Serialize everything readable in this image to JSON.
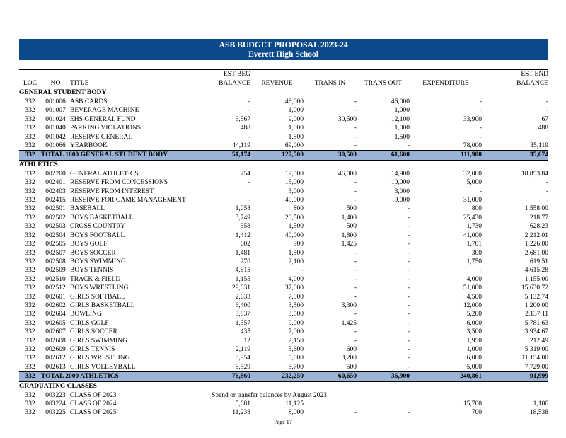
{
  "header": {
    "title": "ASB BUDGET PROPOSAL 2023-24",
    "school": "Everett High School"
  },
  "columns": {
    "row1": [
      "",
      "",
      "",
      "EST BEG",
      "",
      "",
      "",
      "",
      "EST END"
    ],
    "row2": [
      "LOC",
      "NO",
      "TITLE",
      "BALANCE",
      "REVENUE",
      "TRANS IN",
      "TRANS OUT",
      "EXPENDITURE",
      "BALANCE"
    ]
  },
  "sections": [
    {
      "name": "GENERAL STUDENT BODY",
      "rows": [
        [
          "332",
          "001006",
          "ASB CARDS",
          "-",
          "46,000",
          "-",
          "46,000",
          "-",
          "-"
        ],
        [
          "332",
          "001007",
          "BEVERAGE MACHINE",
          "-",
          "1,000",
          "-",
          "1,000",
          "-",
          "-"
        ],
        [
          "332",
          "001024",
          "EHS GENERAL FUND",
          "6,567",
          "9,000",
          "30,500",
          "12,100",
          "33,900",
          "67"
        ],
        [
          "332",
          "001040",
          "PARKING VIOLATIONS",
          "488",
          "1,000",
          "-",
          "1,000",
          "-",
          "488"
        ],
        [
          "332",
          "001042",
          "RESERVE GENERAL",
          "-",
          "1,500",
          "-",
          "1,500",
          "-",
          "-"
        ],
        [
          "332",
          "001066",
          "YEARBOOK",
          "44,119",
          "69,000",
          "-",
          "-",
          "78,000",
          "35,119"
        ]
      ],
      "total": [
        "332",
        "TOTAL 1000 GENERAL STUDENT BODY",
        "51,174",
        "127,500",
        "30,500",
        "61,600",
        "111,900",
        "35,674"
      ]
    },
    {
      "name": "ATHLETICS",
      "rows": [
        [
          "332",
          "002200",
          "GENERAL ATHLETICS",
          "254",
          "19,500",
          "46,000",
          "14,900",
          "32,000",
          "18,853.84"
        ],
        [
          "332",
          "002401",
          "RESERVE FROM CONCESSIONS",
          "-",
          "15,000",
          "-",
          "10,000",
          "5,000",
          "-"
        ],
        [
          "332",
          "002403",
          "RESERVE FROM INTEREST",
          "",
          "3,000",
          "-",
          "3,000",
          "-",
          "-"
        ],
        [
          "332",
          "002415",
          "RESERVE FOR GAME MANAGEMENT",
          "-",
          "40,000",
          "-",
          "9,000",
          "31,000",
          "-"
        ],
        [
          "332",
          "002501",
          "BASEBALL",
          "1,058",
          "800",
          "500",
          "-",
          "800",
          "1,558.00"
        ],
        [
          "332",
          "002502",
          "BOYS BASKETBALL",
          "3,749",
          "20,500",
          "1,400",
          "-",
          "25,430",
          "218.77"
        ],
        [
          "332",
          "002503",
          "CROSS COUNTRY",
          "358",
          "1,500",
          "500",
          "-",
          "1,730",
          "628.23"
        ],
        [
          "332",
          "002504",
          "BOYS FOOTBALL",
          "1,412",
          "40,000",
          "1,800",
          "-",
          "41,000",
          "2,212.01"
        ],
        [
          "332",
          "002505",
          "BOYS GOLF",
          "602",
          "900",
          "1,425",
          "-",
          "1,701",
          "1,226.00"
        ],
        [
          "332",
          "002507",
          "BOYS SOCCER",
          "1,481",
          "1,500",
          "-",
          "-",
          "300",
          "2,681.00"
        ],
        [
          "332",
          "002508",
          "BOYS SWIMMING",
          "270",
          "2,100",
          "-",
          "-",
          "1,750",
          "619.51"
        ],
        [
          "332",
          "002509",
          "BOYS TENNIS",
          "4,615",
          "-",
          "-",
          "-",
          "-",
          "4,615.28"
        ],
        [
          "332",
          "002510",
          "TRACK & FIELD",
          "1,155",
          "4,000",
          "-",
          "-",
          "4,000",
          "1,155.00"
        ],
        [
          "332",
          "002512",
          "BOYS WRESTLING",
          "29,631",
          "37,000",
          "-",
          "-",
          "51,000",
          "15,630.72"
        ],
        [
          "332",
          "002601",
          "GIRLS SOFTBALL",
          "2,633",
          "7,000",
          "-",
          "-",
          "4,500",
          "5,132.74"
        ],
        [
          "332",
          "002602",
          "GIRLS BASKETBALL",
          "6,400",
          "3,500",
          "3,300",
          "-",
          "12,000",
          "1,200.00"
        ],
        [
          "332",
          "002604",
          "BOWLING",
          "3,837",
          "3,500",
          "-",
          "-",
          "5,200",
          "2,137.11"
        ],
        [
          "332",
          "002605",
          "GIRLS GOLF",
          "1,357",
          "9,000",
          "1,425",
          "-",
          "6,000",
          "5,781.63"
        ],
        [
          "332",
          "002607",
          "GIRLS SOCCER",
          "435",
          "7,000",
          "-",
          "-",
          "3,500",
          "3,934.67"
        ],
        [
          "332",
          "002608",
          "GIRLS SWIMMING",
          "12",
          "2,150",
          "-",
          "-",
          "1,950",
          "212.49"
        ],
        [
          "332",
          "002609",
          "GIRLS TENNIS",
          "2,119",
          "3,600",
          "600",
          "-",
          "1,000",
          "5,319.00"
        ],
        [
          "332",
          "002612",
          "GIRLS WRESTLING",
          "8,954",
          "5,000",
          "3,200",
          "-",
          "6,000",
          "11,154.00"
        ],
        [
          "332",
          "002613",
          "GIRLS VOLLEYBALL",
          "6,529",
          "5,700",
          "500",
          "-",
          "5,000",
          "7,729.00"
        ]
      ],
      "total": [
        "332",
        "TOTAL 2000 ATHLETICS",
        "76,860",
        "232,250",
        "60,650",
        "36,900",
        "240,861",
        "91,999"
      ]
    }
  ],
  "graduating": {
    "name": "GRADUATING CLASSES",
    "note": "Spend or transfer balances by August 2023",
    "rows": [
      [
        "332",
        "003223",
        "CLASS OF 2023",
        "",
        "",
        "",
        "",
        "",
        ""
      ],
      [
        "332",
        "003224",
        "CLASS OF 2024",
        "5,681",
        "11,125",
        "",
        "",
        "15,700",
        "1,106"
      ],
      [
        "332",
        "003225",
        "CLASS OF 2025",
        "11,238",
        "8,000",
        "-",
        "-",
        "700",
        "18,538"
      ]
    ]
  },
  "footer": {
    "page": "Page 17"
  }
}
